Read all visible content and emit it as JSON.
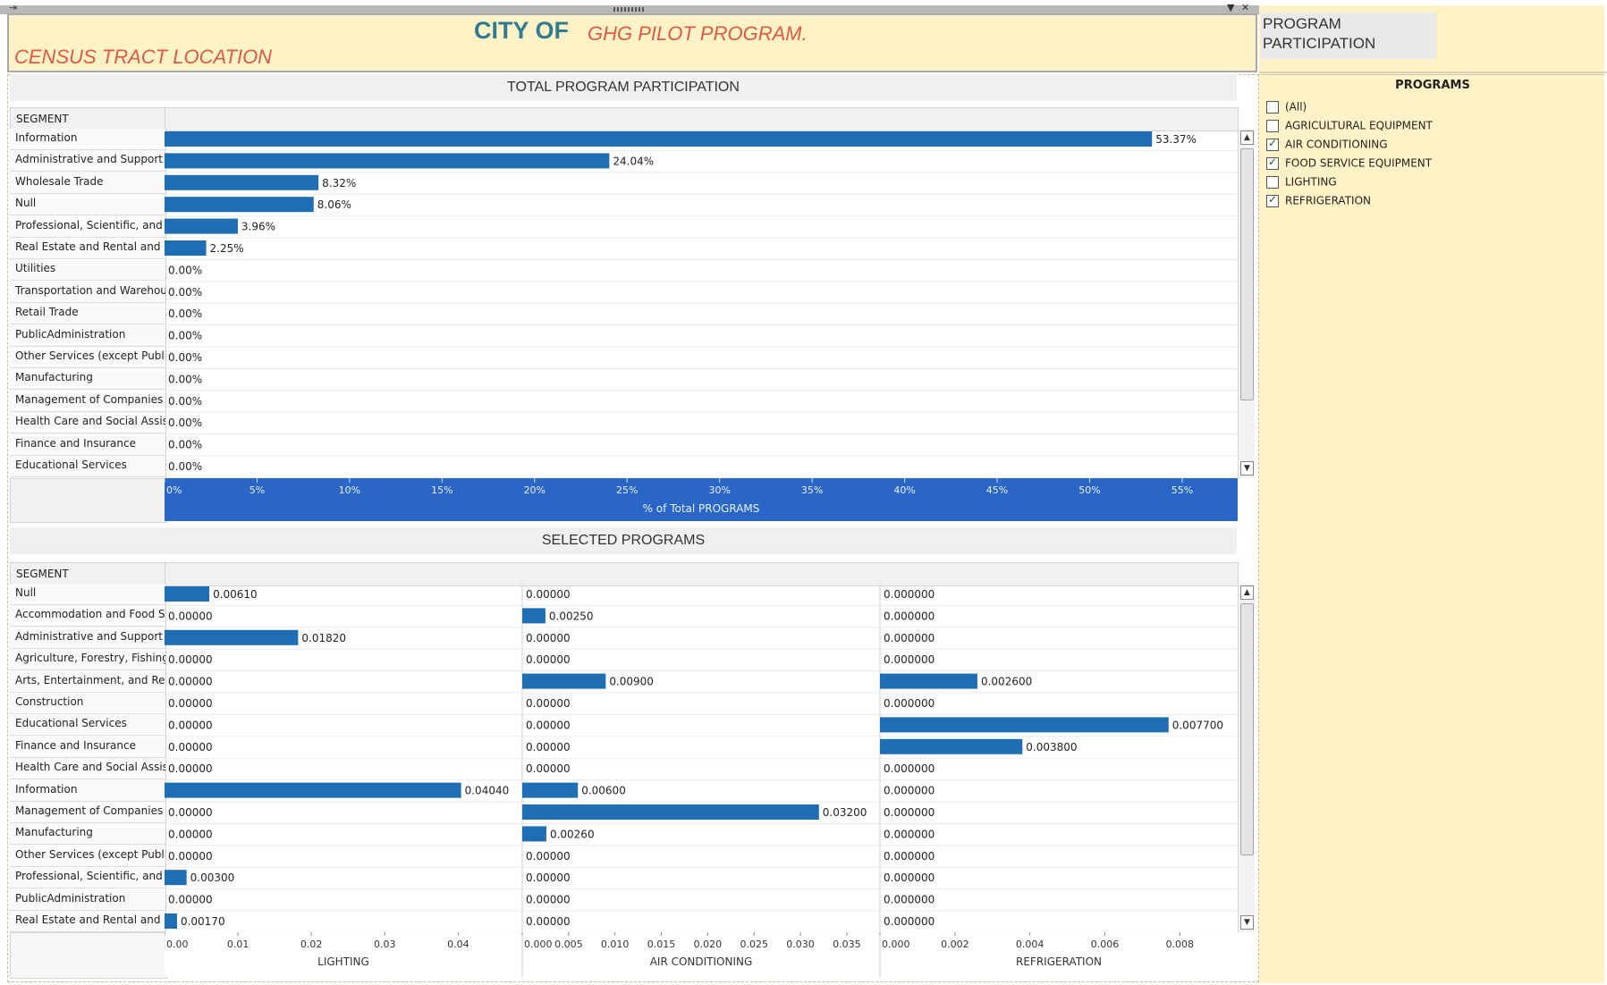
{
  "header": {
    "city_label": "CITY OF",
    "program_title": "GHG PILOT PROGRAM.",
    "subtitle": "CENSUS TRACT LOCATION"
  },
  "right_panel": {
    "title": "PROGRAM PARTICIPATION",
    "filter": {
      "title": "PROGRAMS",
      "items": [
        {
          "label": "(All)",
          "checked": false
        },
        {
          "label": "AGRICULTURAL EQUIPMENT",
          "checked": false
        },
        {
          "label": "AIR CONDITIONING",
          "checked": true
        },
        {
          "label": "FOOD SERVICE EQUIPMENT",
          "checked": true
        },
        {
          "label": "LIGHTING",
          "checked": false
        },
        {
          "label": "REFRIGERATION",
          "checked": true
        }
      ]
    }
  },
  "chart_data": [
    {
      "type": "bar",
      "orientation": "horizontal",
      "title": "TOTAL PROGRAM PARTICIPATION",
      "row_header": "SEGMENT",
      "categories": [
        "Information",
        "Administrative and Support a..",
        "Wholesale Trade",
        "Null",
        "Professional, Scientific, and ..",
        "Real Estate and Rental and L..",
        "Utilities",
        "Transportation and Warehou..",
        "Retail Trade",
        "PublicAdministration",
        "Other Services (except Publi..",
        "Manufacturing",
        "Management of Companies ..",
        "Health Care and Social Assist..",
        "Finance and Insurance",
        "Educational Services"
      ],
      "values": [
        53.37,
        24.04,
        8.32,
        8.06,
        3.96,
        2.25,
        0,
        0,
        0,
        0,
        0,
        0,
        0,
        0,
        0,
        0
      ],
      "data_labels": [
        "53.37%",
        "24.04%",
        "8.32%",
        "8.06%",
        "3.96%",
        "2.25%",
        "0.00%",
        "0.00%",
        "0.00%",
        "0.00%",
        "0.00%",
        "0.00%",
        "0.00%",
        "0.00%",
        "0.00%",
        "0.00%"
      ],
      "xlabel": "% of Total  PROGRAMS",
      "xlim": [
        0,
        58
      ],
      "xticks": [
        0,
        5,
        10,
        15,
        20,
        25,
        30,
        35,
        40,
        45,
        50,
        55
      ],
      "xtick_labels": [
        "0%",
        "5%",
        "10%",
        "15%",
        "20%",
        "25%",
        "30%",
        "35%",
        "40%",
        "45%",
        "50%",
        "55%"
      ],
      "bar_color": "#1f6db3",
      "axis_background": "#2a66c6"
    },
    {
      "type": "bar",
      "orientation": "horizontal",
      "title": "SELECTED PROGRAMS",
      "row_header": "SEGMENT",
      "categories": [
        "Null",
        "Accommodation and Food S..",
        "Administrative and Support a..",
        "Agriculture, Forestry, Fishing..",
        "Arts, Entertainment, and Rec..",
        "Construction",
        "Educational Services",
        "Finance and Insurance",
        "Health Care and Social Assist..",
        "Information",
        "Management of Companies ..",
        "Manufacturing",
        "Other Services (except Publi..",
        "Professional, Scientific, and ..",
        "PublicAdministration",
        "Real Estate and Rental and L.."
      ],
      "panels": [
        {
          "name": "LIGHTING",
          "values": [
            0.0061,
            0,
            0.0182,
            0,
            0,
            0,
            0,
            0,
            0,
            0.0404,
            0,
            0,
            0,
            0.003,
            0,
            0.0017
          ],
          "data_labels": [
            "0.00610",
            "0.00000",
            "0.01820",
            "0.00000",
            "0.00000",
            "0.00000",
            "0.00000",
            "0.00000",
            "0.00000",
            "0.04040",
            "0.00000",
            "0.00000",
            "0.00000",
            "0.00300",
            "0.00000",
            "0.00170"
          ],
          "xlim": [
            0,
            0.048
          ],
          "xticks": [
            0,
            0.01,
            0.02,
            0.03,
            0.04
          ],
          "xtick_labels": [
            "0.00",
            "0.01",
            "0.02",
            "0.03",
            "0.04"
          ]
        },
        {
          "name": "AIR CONDITIONING",
          "values": [
            0,
            0.0025,
            0,
            0,
            0.009,
            0,
            0,
            0,
            0,
            0.006,
            0.032,
            0.0026,
            0,
            0,
            0,
            0
          ],
          "data_labels": [
            "0.00000",
            "0.00250",
            "0.00000",
            "0.00000",
            "0.00900",
            "0.00000",
            "0.00000",
            "0.00000",
            "0.00000",
            "0.00600",
            "0.03200",
            "0.00260",
            "0.00000",
            "0.00000",
            "0.00000",
            "0.00000"
          ],
          "xlim": [
            0,
            0.038
          ],
          "xticks": [
            0,
            0.005,
            0.01,
            0.015,
            0.02,
            0.025,
            0.03,
            0.035
          ],
          "xtick_labels": [
            "0.000",
            "0.005",
            "0.010",
            "0.015",
            "0.020",
            "0.025",
            "0.030",
            "0.035"
          ]
        },
        {
          "name": "REFRIGERATION",
          "values": [
            0,
            0,
            0,
            0,
            0.0026,
            0,
            0.0077,
            0.0038,
            0,
            0,
            0,
            0,
            0,
            0,
            0,
            0
          ],
          "data_labels": [
            "0.000000",
            "0.000000",
            "0.000000",
            "0.000000",
            "0.002600",
            "0.000000",
            "0.007700",
            "0.003800",
            "0.000000",
            "0.000000",
            "0.000000",
            "0.000000",
            "0.000000",
            "0.000000",
            "0.000000",
            "0.000000"
          ],
          "xlim": [
            0,
            0.0094
          ],
          "xticks": [
            0,
            0.002,
            0.004,
            0.006,
            0.008
          ],
          "xtick_labels": [
            "0.000",
            "0.002",
            "0.004",
            "0.006",
            "0.008"
          ]
        }
      ],
      "bar_color": "#1f6db3"
    }
  ]
}
